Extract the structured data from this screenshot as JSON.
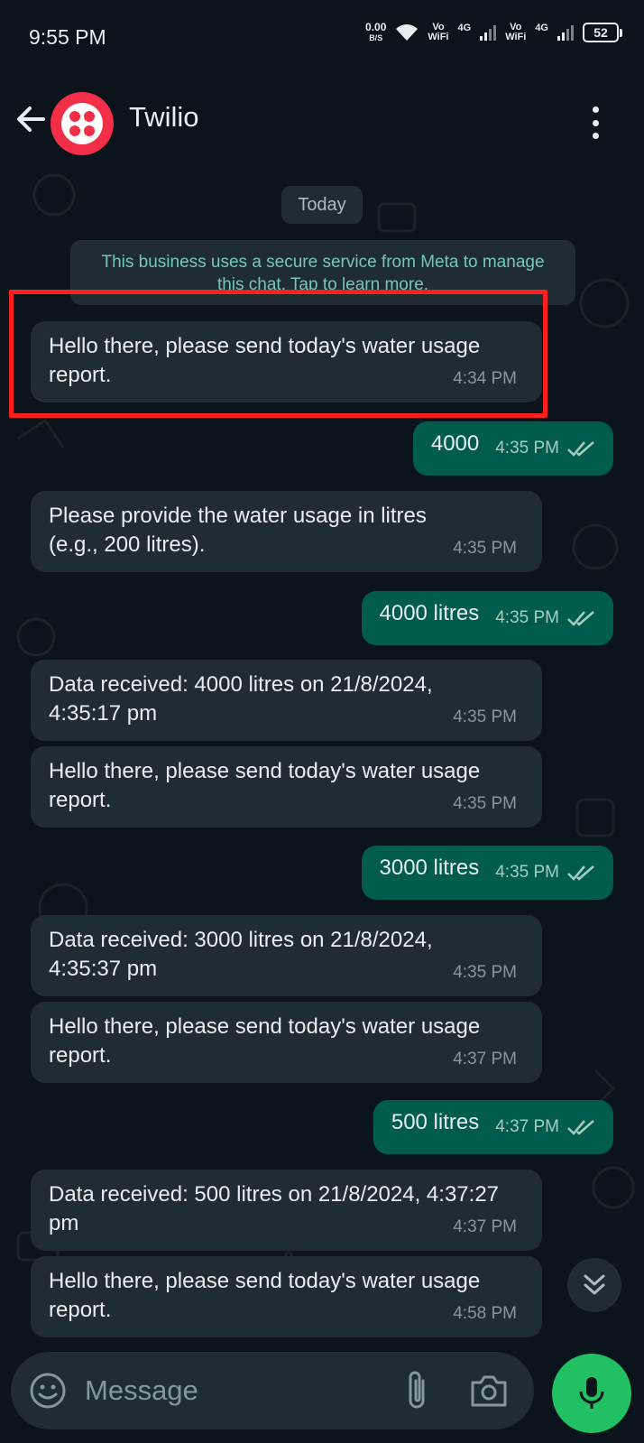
{
  "status_bar": {
    "time": "9:55 PM",
    "net_speed": "0.00",
    "net_speed_unit": "B/S",
    "vowifi_1_top": "Vo",
    "vowifi_1_bottom": "WiFi",
    "network_1": "4G",
    "vowifi_2_top": "Vo",
    "vowifi_2_bottom": "WiFi",
    "network_2": "4G",
    "battery": "52",
    "icons": [
      "wifi-icon",
      "signal-icon",
      "battery-icon"
    ]
  },
  "header": {
    "contact_name": "Twilio",
    "icons": [
      "back-arrow-icon",
      "twilio-logo",
      "more-vertical-icon"
    ]
  },
  "chat": {
    "date_chip": "Today",
    "system_notice": "This business uses a secure service from Meta to manage this chat. Tap to learn more.",
    "messages": [
      {
        "dir": "in",
        "text": "Hello there, please send today's water usage report.",
        "time": "4:34 PM"
      },
      {
        "dir": "out",
        "text": "4000",
        "time": "4:35 PM",
        "status": "read"
      },
      {
        "dir": "in",
        "text": "Please provide the water usage in litres (e.g., 200 litres).",
        "time": "4:35 PM"
      },
      {
        "dir": "out",
        "text": "4000 litres",
        "time": "4:35 PM",
        "status": "read"
      },
      {
        "dir": "in",
        "text": "Data received: 4000 litres on 21/8/2024, 4:35:17 pm",
        "time": "4:35 PM"
      },
      {
        "dir": "in",
        "text": "Hello there, please send today's water usage report.",
        "time": "4:35 PM"
      },
      {
        "dir": "out",
        "text": "3000 litres",
        "time": "4:35 PM",
        "status": "read"
      },
      {
        "dir": "in",
        "text": "Data received: 3000 litres on 21/8/2024, 4:35:37 pm",
        "time": "4:35 PM"
      },
      {
        "dir": "in",
        "text": "Hello there, please send today's water usage report.",
        "time": "4:37 PM"
      },
      {
        "dir": "out",
        "text": "500 litres",
        "time": "4:37 PM",
        "status": "read"
      },
      {
        "dir": "in",
        "text": "Data received: 500 litres on 21/8/2024, 4:37:27 pm",
        "time": "4:37 PM"
      },
      {
        "dir": "in",
        "text": "Hello there, please send today's water usage report.",
        "time": "4:58 PM"
      }
    ]
  },
  "composer": {
    "placeholder": "Message",
    "icons": [
      "emoji-icon",
      "attach-icon",
      "camera-icon",
      "mic-icon"
    ]
  },
  "colors": {
    "background": "#0b141a",
    "incoming_bubble": "#202c33",
    "outgoing_bubble": "#005c4b",
    "accent_green": "#21c063",
    "notice_text": "#75c8b2",
    "highlight": "#ff1f1f",
    "twilio_red": "#f22f46"
  }
}
